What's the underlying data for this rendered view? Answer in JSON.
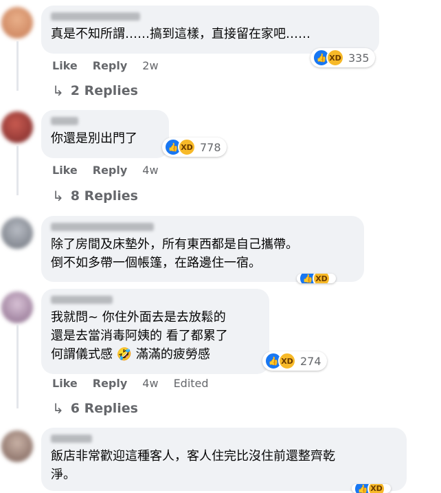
{
  "comments": [
    {
      "text": "真是不知所謂……搞到這樣，直接留在家吧……",
      "reaction_count": "335",
      "actions": {
        "like": "Like",
        "reply": "Reply",
        "time": "2w",
        "edited": ""
      },
      "replies": "2 Replies"
    },
    {
      "text": "你還是別出門了",
      "reaction_count": "778",
      "actions": {
        "like": "Like",
        "reply": "Reply",
        "time": "4w",
        "edited": ""
      },
      "replies": "8 Replies"
    },
    {
      "text": "除了房間及床墊外，所有東西都是自己攜帶。\n倒不如多帶一個帳篷，在路邊住一宿。",
      "reaction_count": "",
      "actions": null,
      "replies": ""
    },
    {
      "text": "我就問~ 你住外面去是去放鬆的\n還是去當消毒阿姨的 看了都累了\n何謂儀式感 🤣 滿滿的疲勞感",
      "reaction_count": "274",
      "actions": {
        "like": "Like",
        "reply": "Reply",
        "time": "4w",
        "edited": "Edited"
      },
      "replies": "6 Replies"
    },
    {
      "text": "飯店非常歡迎這種客人，客人住完比沒住前還整齊乾\n淨。",
      "reaction_count": "",
      "actions": null,
      "replies": ""
    }
  ],
  "colors": {
    "bubble": "#f0f2f5",
    "like_blue": "#1877f2",
    "haha_yellow": "#f7b928",
    "meta_gray": "#65676b"
  },
  "icons": [
    "like-reaction-icon",
    "haha-reaction-icon",
    "reply-arrow-icon"
  ]
}
